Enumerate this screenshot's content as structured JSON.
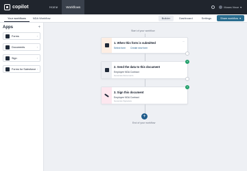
{
  "topbar": {
    "logo_text": "copilot",
    "nav": [
      {
        "label": "Home"
      },
      {
        "label": "Workflows"
      }
    ],
    "user_name": "Moses Vince"
  },
  "subbar": {
    "tabs": [
      {
        "label": "Your workflows"
      },
      {
        "label": "NDA Workflow"
      }
    ],
    "builder": "Builder",
    "dashboard": "Dashboard",
    "settings": "Settings",
    "share": "Share workflow"
  },
  "sidebar": {
    "title": "Apps",
    "plus": "+",
    "apps": [
      {
        "label": "Forms"
      },
      {
        "label": "Documents"
      },
      {
        "label": "Sign"
      },
      {
        "label": "Forms for Salesforce"
      }
    ]
  },
  "flow": {
    "start_caption": "Start of your workflow",
    "end_caption": "End of your workflow",
    "steps": [
      {
        "title": "1. When this form is submitted",
        "link1": "Select form",
        "link2": "Create new form"
      },
      {
        "title": "2. Send the data to this document",
        "subtitle": "Employee NDA Contract",
        "subtitle2": "Generate Documents",
        "add": "+"
      },
      {
        "title": "3. Sign this document",
        "subtitle": "Employee NDA Contract",
        "subtitle2": "Generate Signature",
        "add": "+"
      }
    ],
    "add_node": "+"
  },
  "colors": {
    "topbar": "#20252d",
    "accent": "#1f5c8b",
    "form_icon_bg": "#fdeee3",
    "doc_icon_bg": "#eceef2",
    "sign_icon_bg": "#fde7ef",
    "connector_dot": "#22a06b"
  }
}
